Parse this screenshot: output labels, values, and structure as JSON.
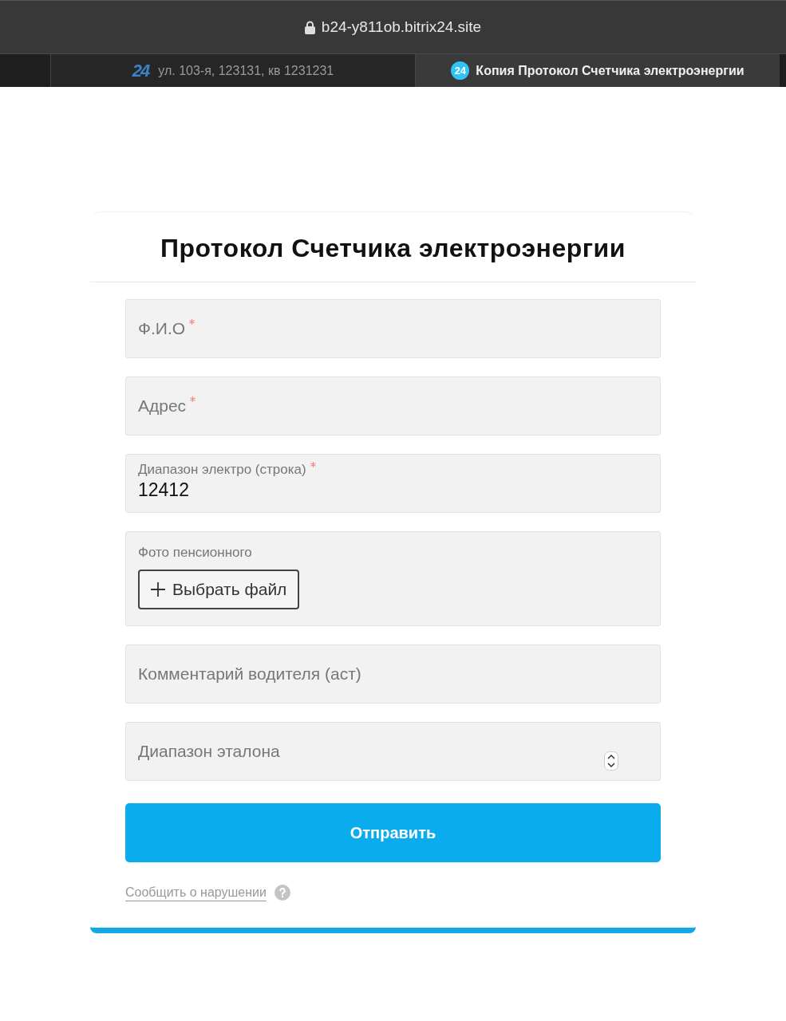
{
  "address_bar": {
    "url": "b24-y811ob.bitrix24.site"
  },
  "tabs": [
    {
      "logo": "24",
      "title": "ул. 103-я, 123131, кв 1231231",
      "selected": false
    },
    {
      "logo": "24",
      "title": "Копия Протокол Счетчика электроэнергии",
      "selected": true
    }
  ],
  "form": {
    "title": "Протокол Счетчика электроэнергии",
    "fields": [
      {
        "kind": "text",
        "label": "Ф.И.О",
        "required": true
      },
      {
        "kind": "text",
        "label": "Адрес",
        "required": true
      },
      {
        "kind": "text",
        "label": "Диапазон электро (строка)",
        "required": true,
        "value": "12412"
      },
      {
        "kind": "file",
        "label": "Фото пенсионного",
        "required": false,
        "button": "Выбрать файл"
      },
      {
        "kind": "text",
        "label": "Комментарий водителя (аст)",
        "required": false
      },
      {
        "kind": "select",
        "label": "Диапазон эталона",
        "required": false
      }
    ],
    "submit": "Отправить",
    "report_link": "Сообщить о нарушении"
  }
}
